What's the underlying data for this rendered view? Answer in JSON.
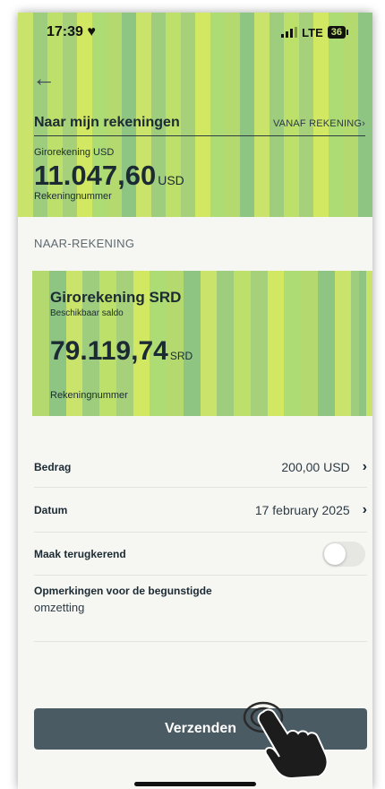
{
  "status_bar": {
    "time": "17:39",
    "heart": "♥",
    "network": "LTE",
    "battery": "36"
  },
  "nav": {
    "back_icon": "arrow-left-icon"
  },
  "from_section": {
    "title": "Naar mijn rekeningen",
    "link": "VANAF REKENING",
    "account_name": "Girorekening USD",
    "balance": "11.047,60",
    "currency": "USD",
    "account_number_label": "Rekeningnummer"
  },
  "to_section": {
    "label": "NAAR-REKENING",
    "card": {
      "name": "Girorekening SRD",
      "subtitle": "Beschikbaar saldo",
      "balance": "79.119,74",
      "currency": "SRD",
      "account_number_label": "Rekeningnummer"
    }
  },
  "form": {
    "amount": {
      "label": "Bedrag",
      "value": "200,00 USD"
    },
    "date": {
      "label": "Datum",
      "value": "17 february 2025"
    },
    "recurring": {
      "label": "Maak terugkerend",
      "enabled": false
    },
    "remarks": {
      "label": "Opmerkingen voor de begunstigde",
      "value": "omzetting"
    }
  },
  "send_button": {
    "label": "Verzenden"
  },
  "colors": {
    "stripe_palette": [
      "#c9e36b",
      "#a6d07a",
      "#b4d96e",
      "#9fcd7e",
      "#d3e862",
      "#8fc583",
      "#bde06a",
      "#addb74"
    ],
    "button": "#4b5b64",
    "text_dark": "#1b2a33"
  }
}
